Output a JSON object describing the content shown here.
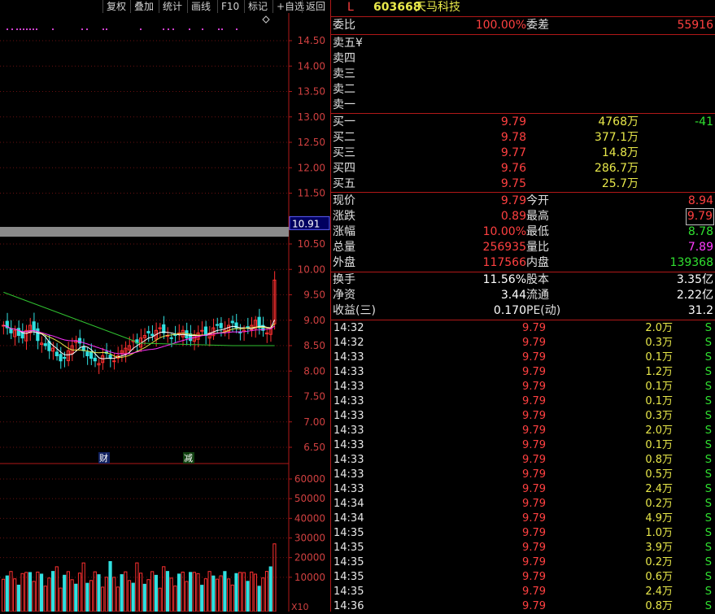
{
  "toolbar": {
    "buttons": [
      "复权",
      "叠加",
      "统计",
      "画线",
      "F10",
      "标记",
      "+自选",
      "返回"
    ]
  },
  "chart": {
    "price_axis": [
      "14.50",
      "14.00",
      "13.50",
      "13.00",
      "12.50",
      "12.00",
      "11.50",
      "10.50",
      "10.00",
      "9.50",
      "9.00",
      "8.50",
      "8.00",
      "7.50",
      "7.00",
      "6.50"
    ],
    "current_price_label": "10.91",
    "markers": [
      "财",
      "减"
    ],
    "volume_axis": [
      "60000",
      "50000",
      "40000",
      "30000",
      "20000",
      "10000"
    ],
    "volume_unit": "X10",
    "colors": {
      "up": "#ff3030",
      "down": "#30e0e0",
      "ma5": "#ffffff",
      "ma10": "#e8e84a",
      "ma20": "#ff30ff",
      "ma60": "#30c030"
    }
  },
  "header": {
    "market": "L",
    "code": "603668",
    "name": "天马科技"
  },
  "order_ratio": {
    "label": "委比",
    "value": "100.00%",
    "diff_label": "委差",
    "diff_value": "55916"
  },
  "sell": [
    {
      "label": "卖五",
      "value": "¥"
    },
    {
      "label": "卖四",
      "value": ""
    },
    {
      "label": "卖三",
      "value": ""
    },
    {
      "label": "卖二",
      "value": ""
    },
    {
      "label": "卖一",
      "value": ""
    }
  ],
  "buy": [
    {
      "label": "买一",
      "price": "9.79",
      "volume": "4768万",
      "change": "-41"
    },
    {
      "label": "买二",
      "price": "9.78",
      "volume": "377.1万",
      "change": ""
    },
    {
      "label": "买三",
      "price": "9.77",
      "volume": "14.8万",
      "change": ""
    },
    {
      "label": "买四",
      "price": "9.76",
      "volume": "286.7万",
      "change": ""
    },
    {
      "label": "买五",
      "price": "9.75",
      "volume": "25.7万",
      "change": ""
    }
  ],
  "quote": [
    {
      "l1": "现价",
      "v1": "9.79",
      "l2": "今开",
      "v2": "8.94"
    },
    {
      "l1": "涨跌",
      "v1": "0.89",
      "l2": "最高",
      "v2": "9.79"
    },
    {
      "l1": "涨幅",
      "v1": "10.00%",
      "l2": "最低",
      "v2": "8.78"
    },
    {
      "l1": "总量",
      "v1": "256935",
      "l2": "量比",
      "v2": "7.89"
    },
    {
      "l1": "外盘",
      "v1": "117566",
      "l2": "内盘",
      "v2": "139368"
    }
  ],
  "fundamentals": [
    {
      "l1": "换手",
      "v1": "11.56%",
      "l2": "股本",
      "v2": "3.35亿"
    },
    {
      "l1": "净资",
      "v1": "3.44",
      "l2": "流通",
      "v2": "2.22亿"
    },
    {
      "l1": "收益(三)",
      "v1": "0.170",
      "l2": "PE(动)",
      "v2": "31.2"
    }
  ],
  "ticks": [
    {
      "time": "14:32",
      "price": "9.79",
      "vol": "2.0万",
      "dir": "S"
    },
    {
      "time": "14:32",
      "price": "9.79",
      "vol": "0.3万",
      "dir": "S"
    },
    {
      "time": "14:33",
      "price": "9.79",
      "vol": "0.1万",
      "dir": "S"
    },
    {
      "time": "14:33",
      "price": "9.79",
      "vol": "1.2万",
      "dir": "S"
    },
    {
      "time": "14:33",
      "price": "9.79",
      "vol": "0.1万",
      "dir": "S"
    },
    {
      "time": "14:33",
      "price": "9.79",
      "vol": "0.1万",
      "dir": "S"
    },
    {
      "time": "14:33",
      "price": "9.79",
      "vol": "0.3万",
      "dir": "S"
    },
    {
      "time": "14:33",
      "price": "9.79",
      "vol": "2.0万",
      "dir": "S"
    },
    {
      "time": "14:33",
      "price": "9.79",
      "vol": "0.1万",
      "dir": "S"
    },
    {
      "time": "14:33",
      "price": "9.79",
      "vol": "0.8万",
      "dir": "S"
    },
    {
      "time": "14:33",
      "price": "9.79",
      "vol": "0.5万",
      "dir": "S"
    },
    {
      "time": "14:33",
      "price": "9.79",
      "vol": "2.4万",
      "dir": "S"
    },
    {
      "time": "14:34",
      "price": "9.79",
      "vol": "0.2万",
      "dir": "S"
    },
    {
      "time": "14:34",
      "price": "9.79",
      "vol": "4.9万",
      "dir": "S"
    },
    {
      "time": "14:35",
      "price": "9.79",
      "vol": "1.0万",
      "dir": "S"
    },
    {
      "time": "14:35",
      "price": "9.79",
      "vol": "3.9万",
      "dir": "S"
    },
    {
      "time": "14:35",
      "price": "9.79",
      "vol": "0.2万",
      "dir": "S"
    },
    {
      "time": "14:35",
      "price": "9.79",
      "vol": "0.6万",
      "dir": "S"
    },
    {
      "time": "14:35",
      "price": "9.79",
      "vol": "2.4万",
      "dir": "S"
    },
    {
      "time": "14:36",
      "price": "9.79",
      "vol": "0.8万",
      "dir": "S"
    }
  ]
}
